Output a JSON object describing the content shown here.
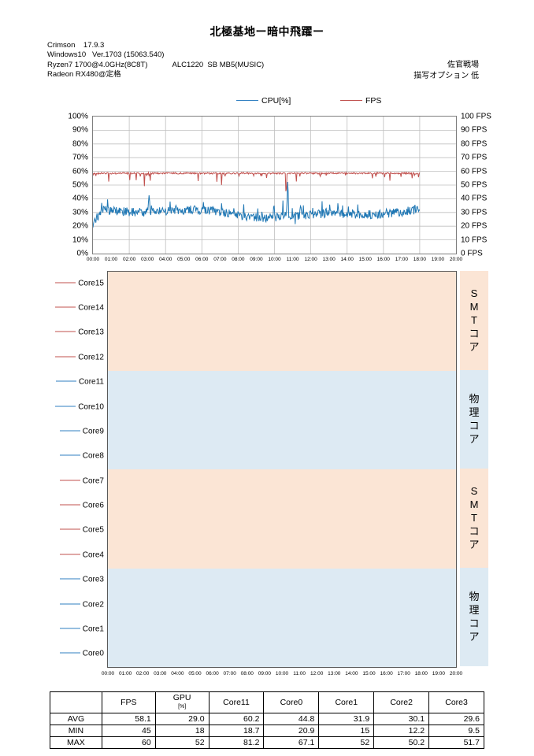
{
  "header": {
    "title": "北極基地ー暗中飛躍ー",
    "sysinfo": [
      "Crimson    17.9.3",
      "Windows10   Ver.1703 (15063.540)",
      "Ryzen7 1700@4.0GHz(8C8T)            ALC1220  SB MB5(MUSIC)",
      "Radeon RX480@定格"
    ],
    "right_info": [
      "佐官戦場",
      "描写オプション  低"
    ]
  },
  "top_chart": {
    "legend": [
      {
        "label": "CPU[%]",
        "color": "#2f7fc1"
      },
      {
        "label": "FPS",
        "color": "#c0504d"
      }
    ],
    "y_left_labels": [
      "100%",
      "90%",
      "80%",
      "70%",
      "60%",
      "50%",
      "40%",
      "30%",
      "20%",
      "10%",
      "0%"
    ],
    "y_right_labels": [
      "100 FPS",
      "90 FPS",
      "80 FPS",
      "70 FPS",
      "60 FPS",
      "50 FPS",
      "40 FPS",
      "30 FPS",
      "20 FPS",
      "10 FPS",
      "0 FPS"
    ],
    "x_labels": [
      "00:00",
      "01:00",
      "02:00",
      "03:00",
      "04:00",
      "05:00",
      "06:00",
      "07:00",
      "08:00",
      "09:00",
      "10:00",
      "11:00",
      "12:00",
      "13:00",
      "14:00",
      "15:00",
      "16:00",
      "17:00",
      "18:00",
      "19:00",
      "20:00"
    ]
  },
  "core_chart": {
    "cores": [
      "Core15",
      "Core14",
      "Core13",
      "Core12",
      "Core11",
      "Core10",
      "Core9",
      "Core8",
      "Core7",
      "Core6",
      "Core5",
      "Core4",
      "Core3",
      "Core2",
      "Core1",
      "Core0"
    ],
    "core_colors": {
      "Core15": "#c0504d",
      "Core14": "#c0504d",
      "Core13": "#c0504d",
      "Core12": "#c0504d",
      "Core11": "#2f7fc1",
      "Core10": "#2f7fc1",
      "Core9": "#2f7fc1",
      "Core8": "#2f7fc1",
      "Core7": "#c0504d",
      "Core6": "#c0504d",
      "Core5": "#c0504d",
      "Core4": "#c0504d",
      "Core3": "#2f7fc1",
      "Core2": "#2f7fc1",
      "Core1": "#2f7fc1",
      "Core0": "#2f7fc1"
    },
    "bands": [
      {
        "label": "SMTコア",
        "chars": [
          "S",
          "M",
          "T",
          "コ",
          "ア"
        ],
        "type": "smt",
        "color": "#fbe5d5"
      },
      {
        "label": "物理コア",
        "chars": [
          "物",
          "理",
          "コ",
          "ア"
        ],
        "type": "phys",
        "color": "#ddeaf3"
      },
      {
        "label": "SMTコア",
        "chars": [
          "S",
          "M",
          "T",
          "コ",
          "ア"
        ],
        "type": "smt",
        "color": "#fbe5d5"
      },
      {
        "label": "物理コア",
        "chars": [
          "物",
          "理",
          "コ",
          "ア"
        ],
        "type": "phys",
        "color": "#ddeaf3"
      }
    ],
    "x_labels": [
      "00:00",
      "01:00",
      "02:00",
      "03:00",
      "04:00",
      "05:00",
      "06:00",
      "07:00",
      "08:00",
      "09:00",
      "10:00",
      "11:00",
      "12:00",
      "13:00",
      "14:00",
      "15:00",
      "16:00",
      "17:00",
      "18:00",
      "19:00",
      "20:00"
    ]
  },
  "chart_data": {
    "type": "line",
    "title": "北極基地ー暗中飛躍ー",
    "xlabel": "",
    "ylabel": "CPU[%] / FPS",
    "ylim": [
      0,
      100
    ],
    "grid": true,
    "legend_position": "top",
    "x": [
      "00:00",
      "01:00",
      "02:00",
      "03:00",
      "04:00",
      "05:00",
      "06:00",
      "07:00",
      "08:00",
      "09:00",
      "10:00",
      "11:00",
      "12:00",
      "13:00",
      "14:00",
      "15:00",
      "16:00",
      "17:00",
      "18:00",
      "19:00",
      "20:00"
    ],
    "series": [
      {
        "name": "CPU[%]",
        "color": "#2f7fc1",
        "axis": "left",
        "values": [
          24,
          29,
          30,
          31,
          32,
          29,
          30,
          30,
          31,
          29,
          30,
          30,
          30,
          30,
          29,
          29,
          29,
          29,
          null,
          null,
          null
        ]
      },
      {
        "name": "FPS",
        "color": "#c0504d",
        "axis": "right",
        "values": [
          58,
          58,
          58,
          58,
          58,
          58,
          58,
          58,
          58,
          58,
          58,
          58,
          58,
          58,
          58,
          58,
          58,
          58,
          null,
          null,
          null
        ]
      }
    ],
    "stats_table": {
      "columns": [
        "",
        "FPS",
        "GPU[%]",
        "Core11",
        "Core0",
        "Core1",
        "Core2",
        "Core3"
      ],
      "rows": [
        {
          "label": "AVG",
          "values": [
            "58.1",
            "29.0",
            "60.2",
            "44.8",
            "31.9",
            "30.1",
            "29.6"
          ]
        },
        {
          "label": "MIN",
          "values": [
            "45",
            "18",
            "18.7",
            "20.9",
            "15",
            "12.2",
            "9.5"
          ]
        },
        {
          "label": "MAX",
          "values": [
            "60",
            "52",
            "81.2",
            "67.1",
            "52",
            "50.2",
            "51.7"
          ]
        }
      ]
    }
  },
  "stats_table": {
    "col_blank": "",
    "col_fps": "FPS",
    "col_gpu": "GPU",
    "col_gpu_unit": "[%]",
    "col_core11": "Core11",
    "col_core0": "Core0",
    "col_core1": "Core1",
    "col_core2": "Core2",
    "col_core3": "Core3",
    "rows": [
      {
        "label": "AVG",
        "fps": "58.1",
        "gpu": "29.0",
        "core11": "60.2",
        "core0": "44.8",
        "core1": "31.9",
        "core2": "30.1",
        "core3": "29.6"
      },
      {
        "label": "MIN",
        "fps": "45",
        "gpu": "18",
        "core11": "18.7",
        "core0": "20.9",
        "core1": "15",
        "core2": "12.2",
        "core3": "9.5"
      },
      {
        "label": "MAX",
        "fps": "60",
        "gpu": "52",
        "core11": "81.2",
        "core0": "67.1",
        "core1": "52",
        "core2": "50.2",
        "core3": "51.7"
      }
    ]
  }
}
